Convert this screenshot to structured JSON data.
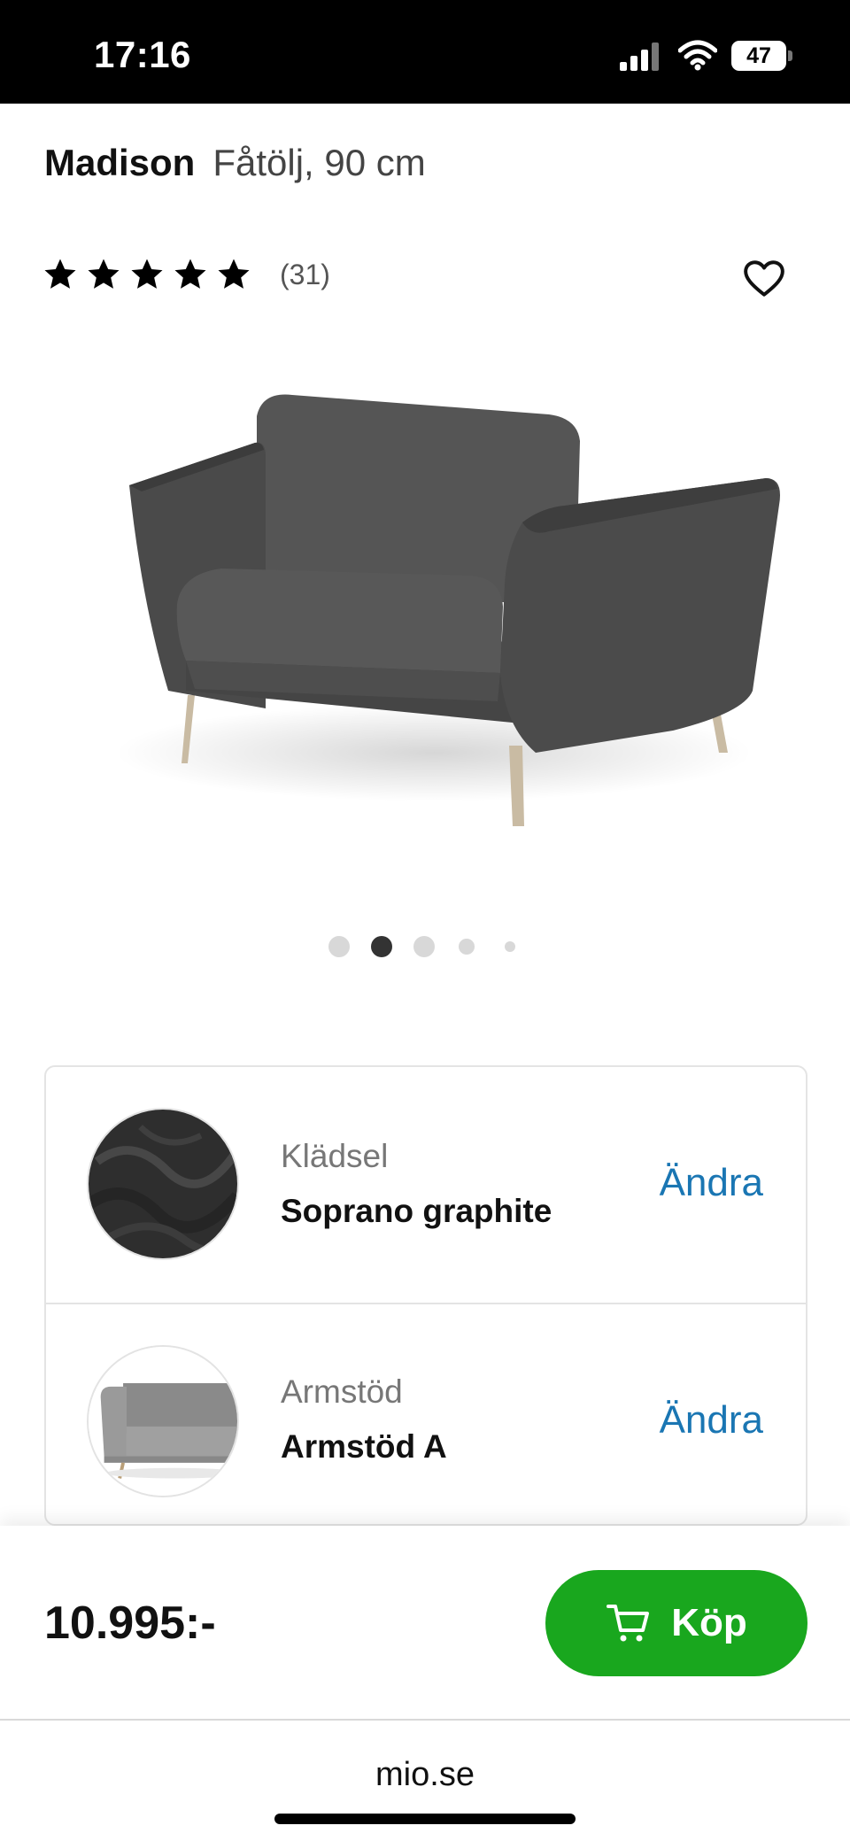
{
  "status_bar": {
    "time": "17:16",
    "battery": "47"
  },
  "product": {
    "name": "Madison",
    "subtitle": "Fåtölj, 90 cm"
  },
  "rating": {
    "stars": 5,
    "count": "(31)"
  },
  "carousel": {
    "total_slides": 5,
    "active_index": 1
  },
  "options": [
    {
      "label": "Klädsel",
      "value": "Soprano graphite",
      "action": "Ändra"
    },
    {
      "label": "Armstöd",
      "value": "Armstöd A",
      "action": "Ändra"
    }
  ],
  "purchase": {
    "price": "10.995:-",
    "buy_label": "Köp"
  },
  "browser": {
    "url": "mio.se"
  },
  "colors": {
    "buy_button": "#19a71e",
    "link": "#1a76b3",
    "sofa_fabric": "#4c4c4c"
  },
  "icons": [
    "signal-icon",
    "wifi-icon",
    "battery-icon",
    "star-icon",
    "heart-icon",
    "cart-icon"
  ]
}
